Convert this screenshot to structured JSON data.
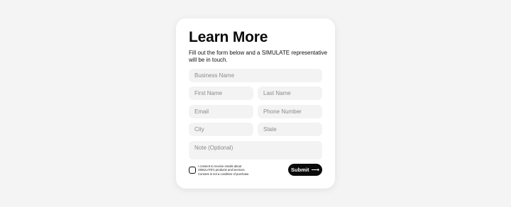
{
  "form": {
    "title": "Learn More",
    "subtitle": "Fill out the form below and a SIMULATE representative will be in touch.",
    "fields": {
      "business_name": "Business Name",
      "first_name": "First Name",
      "last_name": "Last Name",
      "email": "Email",
      "phone": "Phone Number",
      "city": "City",
      "state": "State",
      "note": "Note (Optional)"
    },
    "consent": {
      "line1": "I consent to receive emails about",
      "line2": "SIMULATE's products and services.",
      "line3": "Consent is not a condition of purchase."
    },
    "submit_label": "Submit",
    "submit_icon": "arrow-right-icon"
  }
}
